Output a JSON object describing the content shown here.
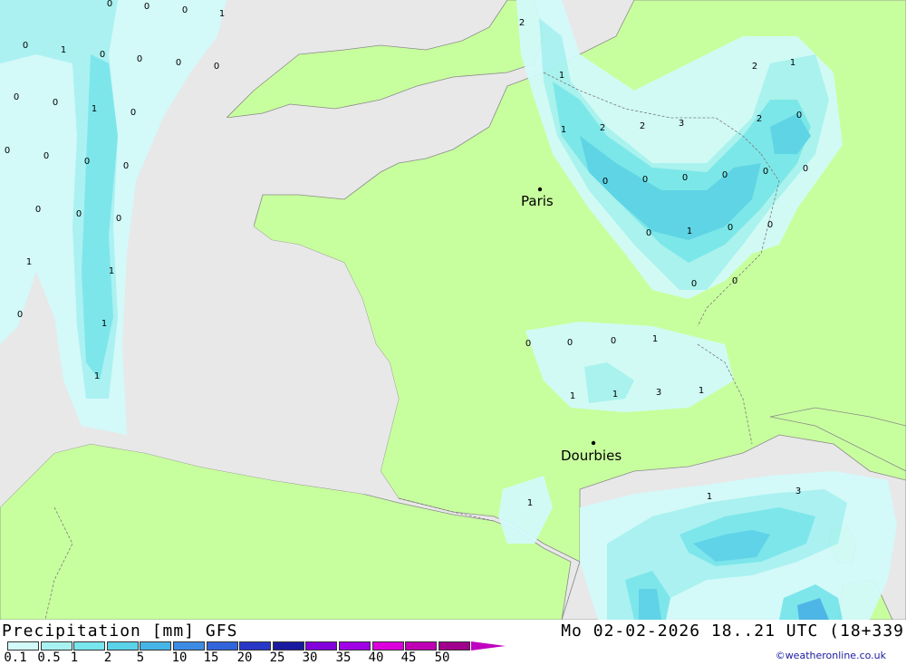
{
  "map": {
    "cities": [
      {
        "name": "Paris"
      },
      {
        "name": "Dourbies"
      }
    ],
    "values": [
      "0",
      "0",
      "0",
      "1",
      "0",
      "1",
      "0",
      "0",
      "0",
      "0",
      "1",
      "0",
      "0",
      "0",
      "0",
      "0",
      "0",
      "0",
      "0",
      "0",
      "0",
      "1",
      "1",
      "0",
      "1",
      "1",
      "2",
      "1",
      "1",
      "2",
      "2",
      "3",
      "2",
      "2",
      "1",
      "0",
      "0",
      "0",
      "0",
      "0",
      "0",
      "0",
      "0",
      "1",
      "0",
      "0",
      "0",
      "0",
      "0",
      "0",
      "0",
      "1",
      "1",
      "1",
      "3",
      "1",
      "1",
      "1",
      "3"
    ],
    "colors": {
      "land": "#c8ff9e",
      "sea": "#e8e8e8",
      "p01": "#d2fafa",
      "p05": "#a8f2f2",
      "p1": "#78e6ec",
      "p2": "#5ad2e8",
      "p5": "#46b4e6"
    }
  },
  "footer": {
    "title": "Precipitation [mm] GFS",
    "date": "Mo 02-02-2026 18..21 UTC (18+339",
    "credit": "©weatheronline.co.uk",
    "legend": {
      "labels": [
        "0.1",
        "0.5",
        "1",
        "2",
        "5",
        "10",
        "15",
        "20",
        "25",
        "30",
        "35",
        "40",
        "45",
        "50"
      ],
      "colors": [
        "#d2fafa",
        "#a8f2f2",
        "#78e6ec",
        "#5ad2e8",
        "#46b4e6",
        "#3c8ce6",
        "#3264dc",
        "#2837c8",
        "#1a1aa0",
        "#8200dc",
        "#a000e6",
        "#dc00dc",
        "#c000b4",
        "#a0008c"
      ]
    }
  }
}
